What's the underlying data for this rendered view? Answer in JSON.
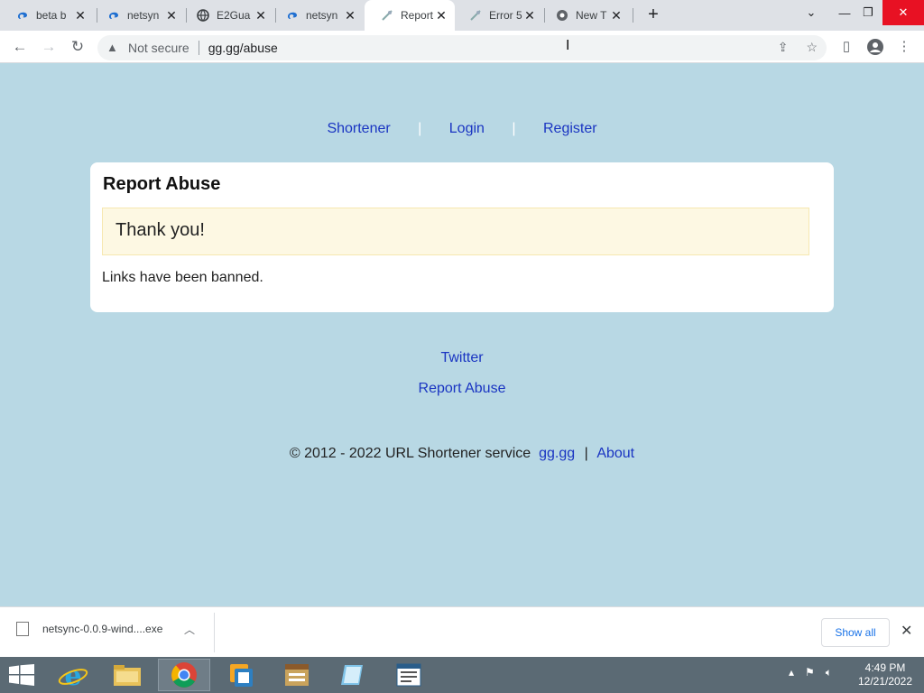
{
  "browser": {
    "tabs": [
      {
        "title": "beta b",
        "icon": "edge-logo-icon"
      },
      {
        "title": "netsyn",
        "icon": "edge-logo-icon"
      },
      {
        "title": "E2Gua",
        "icon": "globe-icon"
      },
      {
        "title": "netsyn",
        "icon": "edge-logo-icon"
      },
      {
        "title": "Report",
        "icon": "loading-icon",
        "active": true
      },
      {
        "title": "Error 5",
        "icon": "loading-icon"
      },
      {
        "title": "New T",
        "icon": "chrome-logo-icon"
      }
    ],
    "address": {
      "security_label": "Not secure",
      "url": "gg.gg/abuse"
    }
  },
  "page": {
    "nav": {
      "shortener": "Shortener",
      "login": "Login",
      "register": "Register",
      "separator": "|"
    },
    "card": {
      "title": "Report Abuse",
      "notice": "Thank you!",
      "message": "Links have been banned."
    },
    "footer": {
      "twitter": "Twitter",
      "report_abuse": "Report Abuse",
      "copyright": "© 2012 - 2022 URL Shortener service",
      "site_link": "gg.gg",
      "separator": "|",
      "about": "About"
    },
    "colors": {
      "background": "#b8d8e4",
      "link": "#1a35c2",
      "notice_bg": "#fdf8e3"
    }
  },
  "downloads": {
    "filename": "netsync-0.0.9-wind....exe",
    "show_all": "Show all"
  },
  "taskbar": {
    "time": "4:49 PM",
    "date": "12/21/2022"
  }
}
